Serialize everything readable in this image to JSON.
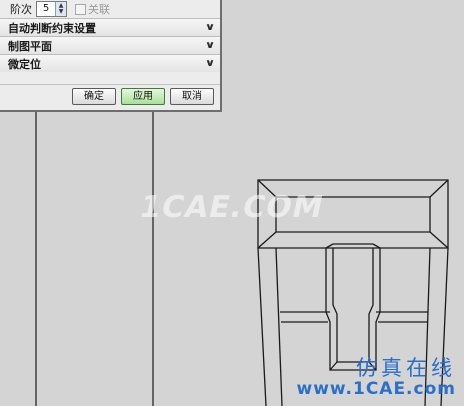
{
  "dialog": {
    "order_label": "阶次",
    "order_value": "5",
    "associative_label": "关联",
    "sections": [
      {
        "label": "自动判断约束设置"
      },
      {
        "label": "制图平面"
      },
      {
        "label": "微定位"
      }
    ],
    "buttons": {
      "ok": "确定",
      "apply": "应用",
      "cancel": "取消"
    }
  },
  "watermark": {
    "text": "1CAE.COM"
  },
  "brand": {
    "cn": "仿真在线",
    "en": "www.1CAE.com",
    "color": "#2a6fc9"
  },
  "colors": {
    "viewport_bg": "#d4d4d4",
    "apply_button": "#a9e09a"
  }
}
